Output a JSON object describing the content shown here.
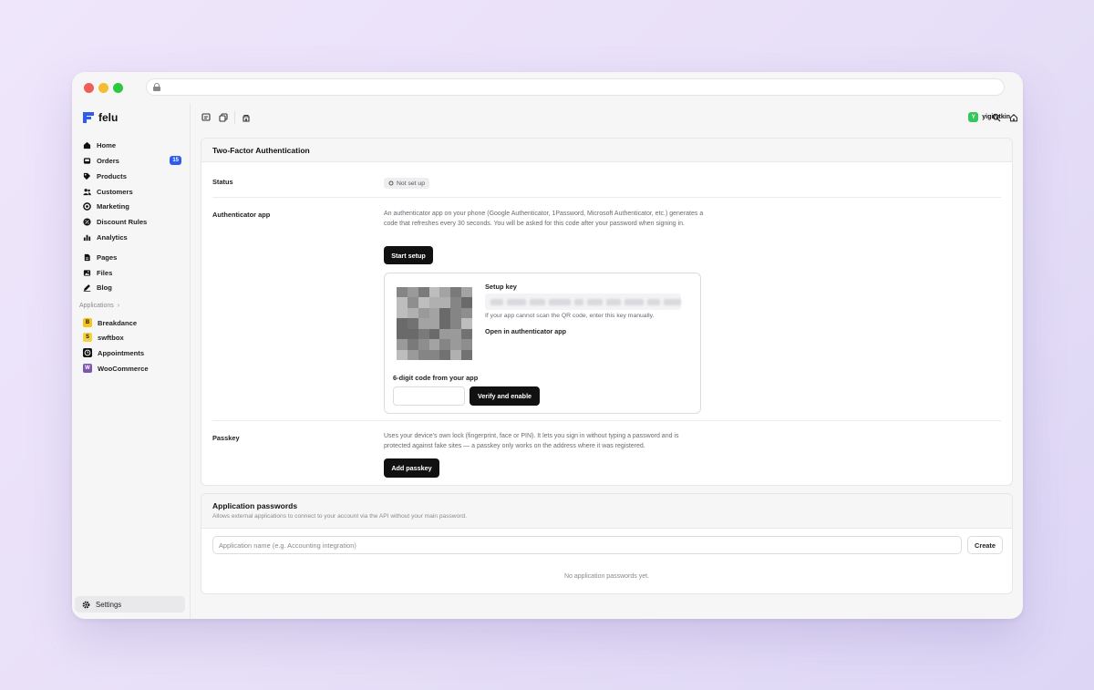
{
  "sidebar": {
    "brand": "felu",
    "nav": [
      {
        "label": "Home",
        "icon": "home-icon"
      },
      {
        "label": "Orders",
        "icon": "inbox-icon",
        "badge": "15"
      },
      {
        "label": "Products",
        "icon": "tag-icon"
      },
      {
        "label": "Customers",
        "icon": "users-icon"
      },
      {
        "label": "Marketing",
        "icon": "megaphone-icon"
      },
      {
        "label": "Discount Rules",
        "icon": "discount-icon"
      },
      {
        "label": "Analytics",
        "icon": "bar-chart-icon"
      }
    ],
    "content": [
      {
        "label": "Pages",
        "icon": "page-icon"
      },
      {
        "label": "Files",
        "icon": "image-icon"
      },
      {
        "label": "Blog",
        "icon": "pen-icon"
      }
    ],
    "applications_label": "Applications",
    "applications": [
      {
        "label": "Breakdance",
        "icon": "breakdance-icon",
        "color": "#f5c518"
      },
      {
        "label": "swftbox",
        "icon": "swftbox-icon",
        "color": "#f3d23c"
      },
      {
        "label": "Appointments",
        "icon": "clock-icon",
        "color": "#111111"
      },
      {
        "label": "WooCommerce",
        "icon": "woocommerce-icon",
        "color": "#7f54b3"
      }
    ],
    "settings_label": "Settings"
  },
  "topbar": {
    "user": "yigitytkin",
    "avatar_initial": "Y"
  },
  "two_factor": {
    "title": "Two-Factor Authentication",
    "status_label": "Status",
    "status_value": "Not set up",
    "auth_app_label": "Authenticator app",
    "auth_app_desc": "An authenticator app on your phone (Google Authenticator, 1Password, Microsoft Authenticator, etc.) generates a code that refreshes every 30 seconds. You will be asked for this code after your password when signing in.",
    "start_setup": "Start setup",
    "setup_key_label": "Setup key",
    "setup_key_hint": "If your app cannot scan the QR code, enter this key manually.",
    "open_in_app": "Open in authenticator app",
    "code_label": "6-digit code from your app",
    "verify_button": "Verify and enable",
    "passkey_label": "Passkey",
    "passkey_desc": "Uses your device's own lock (fingerprint, face or PIN). It lets you sign in without typing a password and is protected against fake sites — a passkey only works on the address where it was registered.",
    "add_passkey": "Add passkey"
  },
  "app_passwords": {
    "title": "Application passwords",
    "subtitle": "Allows external applications to connect to your account via the API without your main password.",
    "input_placeholder": "Application name (e.g. Accounting integration)",
    "create_button": "Create",
    "empty_text": "No application passwords yet."
  },
  "colors": {
    "accent": "#2f5bf0",
    "primary_button": "#111111",
    "avatar": "#34c759"
  }
}
